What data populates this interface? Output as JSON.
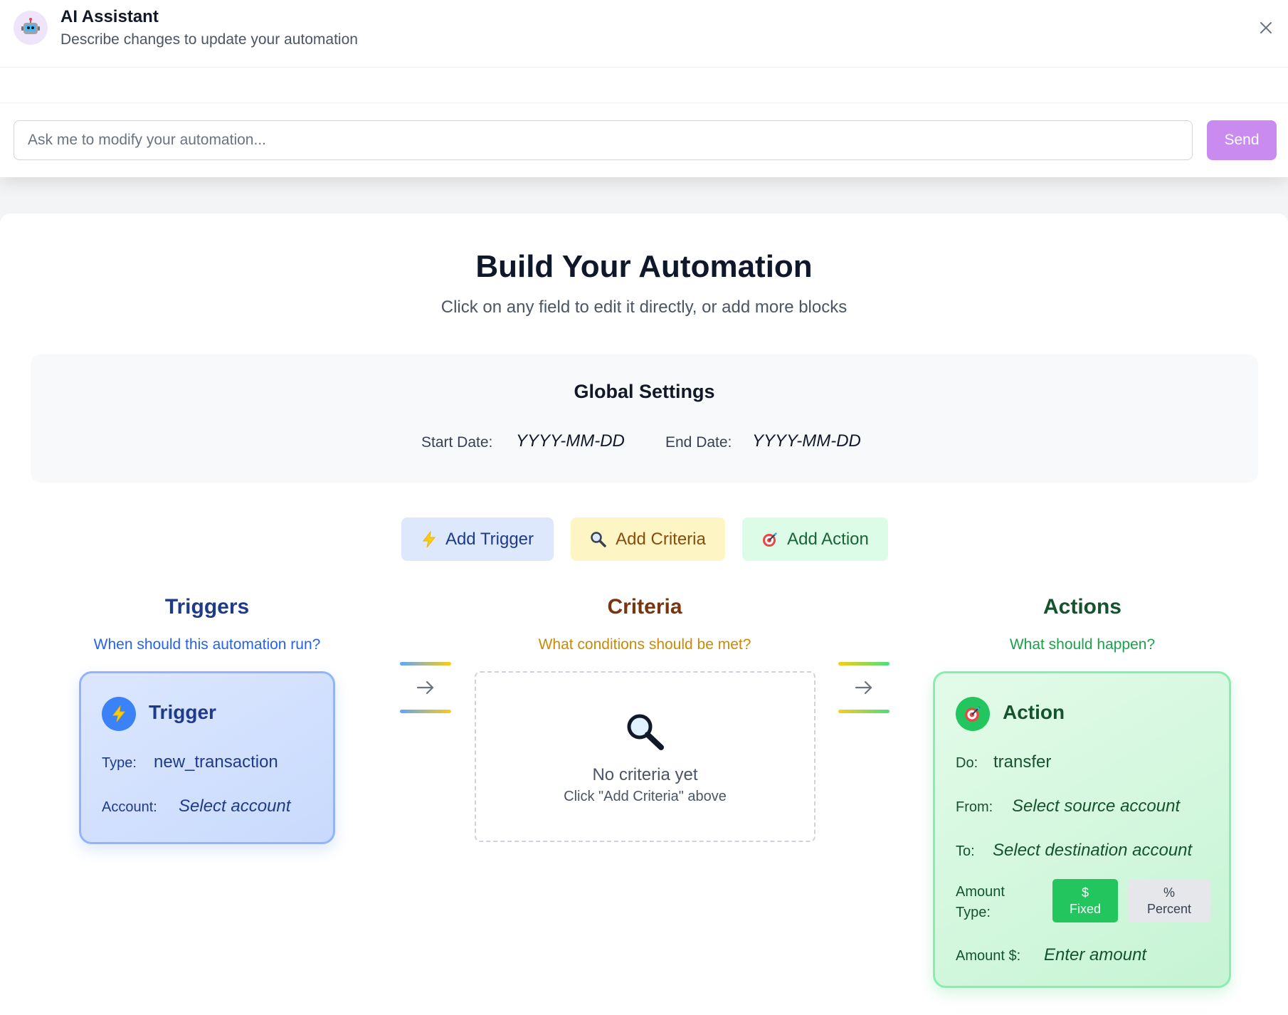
{
  "assistant": {
    "title": "AI Assistant",
    "subtitle": "Describe changes to update your automation",
    "avatar_icon": "robot-icon",
    "input_placeholder": "Ask me to modify your automation...",
    "send_label": "Send",
    "accent_color": "#c98bf0"
  },
  "builder": {
    "title": "Build Your Automation",
    "subtitle": "Click on any field to edit it directly, or add more blocks"
  },
  "global_settings": {
    "title": "Global Settings",
    "start_label": "Start Date:",
    "start_value": "YYYY-MM-DD",
    "end_label": "End Date:",
    "end_value": "YYYY-MM-DD"
  },
  "add_buttons": {
    "trigger": "Add Trigger",
    "criteria": "Add Criteria",
    "action": "Add Action"
  },
  "columns": {
    "triggers": {
      "title": "Triggers",
      "subtitle": "When should this automation run?",
      "color": "#1e3a8a"
    },
    "criteria": {
      "title": "Criteria",
      "subtitle": "What conditions should be met?",
      "color": "#78350f"
    },
    "actions": {
      "title": "Actions",
      "subtitle": "What should happen?",
      "color": "#14532d"
    }
  },
  "trigger_card": {
    "title": "Trigger",
    "type_label": "Type:",
    "type_value": "new_transaction",
    "account_label": "Account:",
    "account_value": "Select account"
  },
  "criteria_card": {
    "empty_title": "No criteria yet",
    "empty_hint": "Click \"Add Criteria\" above"
  },
  "action_card": {
    "title": "Action",
    "do_label": "Do:",
    "do_value": "transfer",
    "from_label": "From:",
    "from_value": "Select source account",
    "to_label": "To:",
    "to_value": "Select destination account",
    "amount_type_label_1": "Amount",
    "amount_type_label_2": "Type:",
    "fixed_symbol": "$",
    "fixed_label": "Fixed",
    "percent_symbol": "%",
    "percent_label": "Percent",
    "selected_amount_type": "Fixed",
    "amount_label": "Amount $:",
    "amount_value": "Enter amount"
  }
}
